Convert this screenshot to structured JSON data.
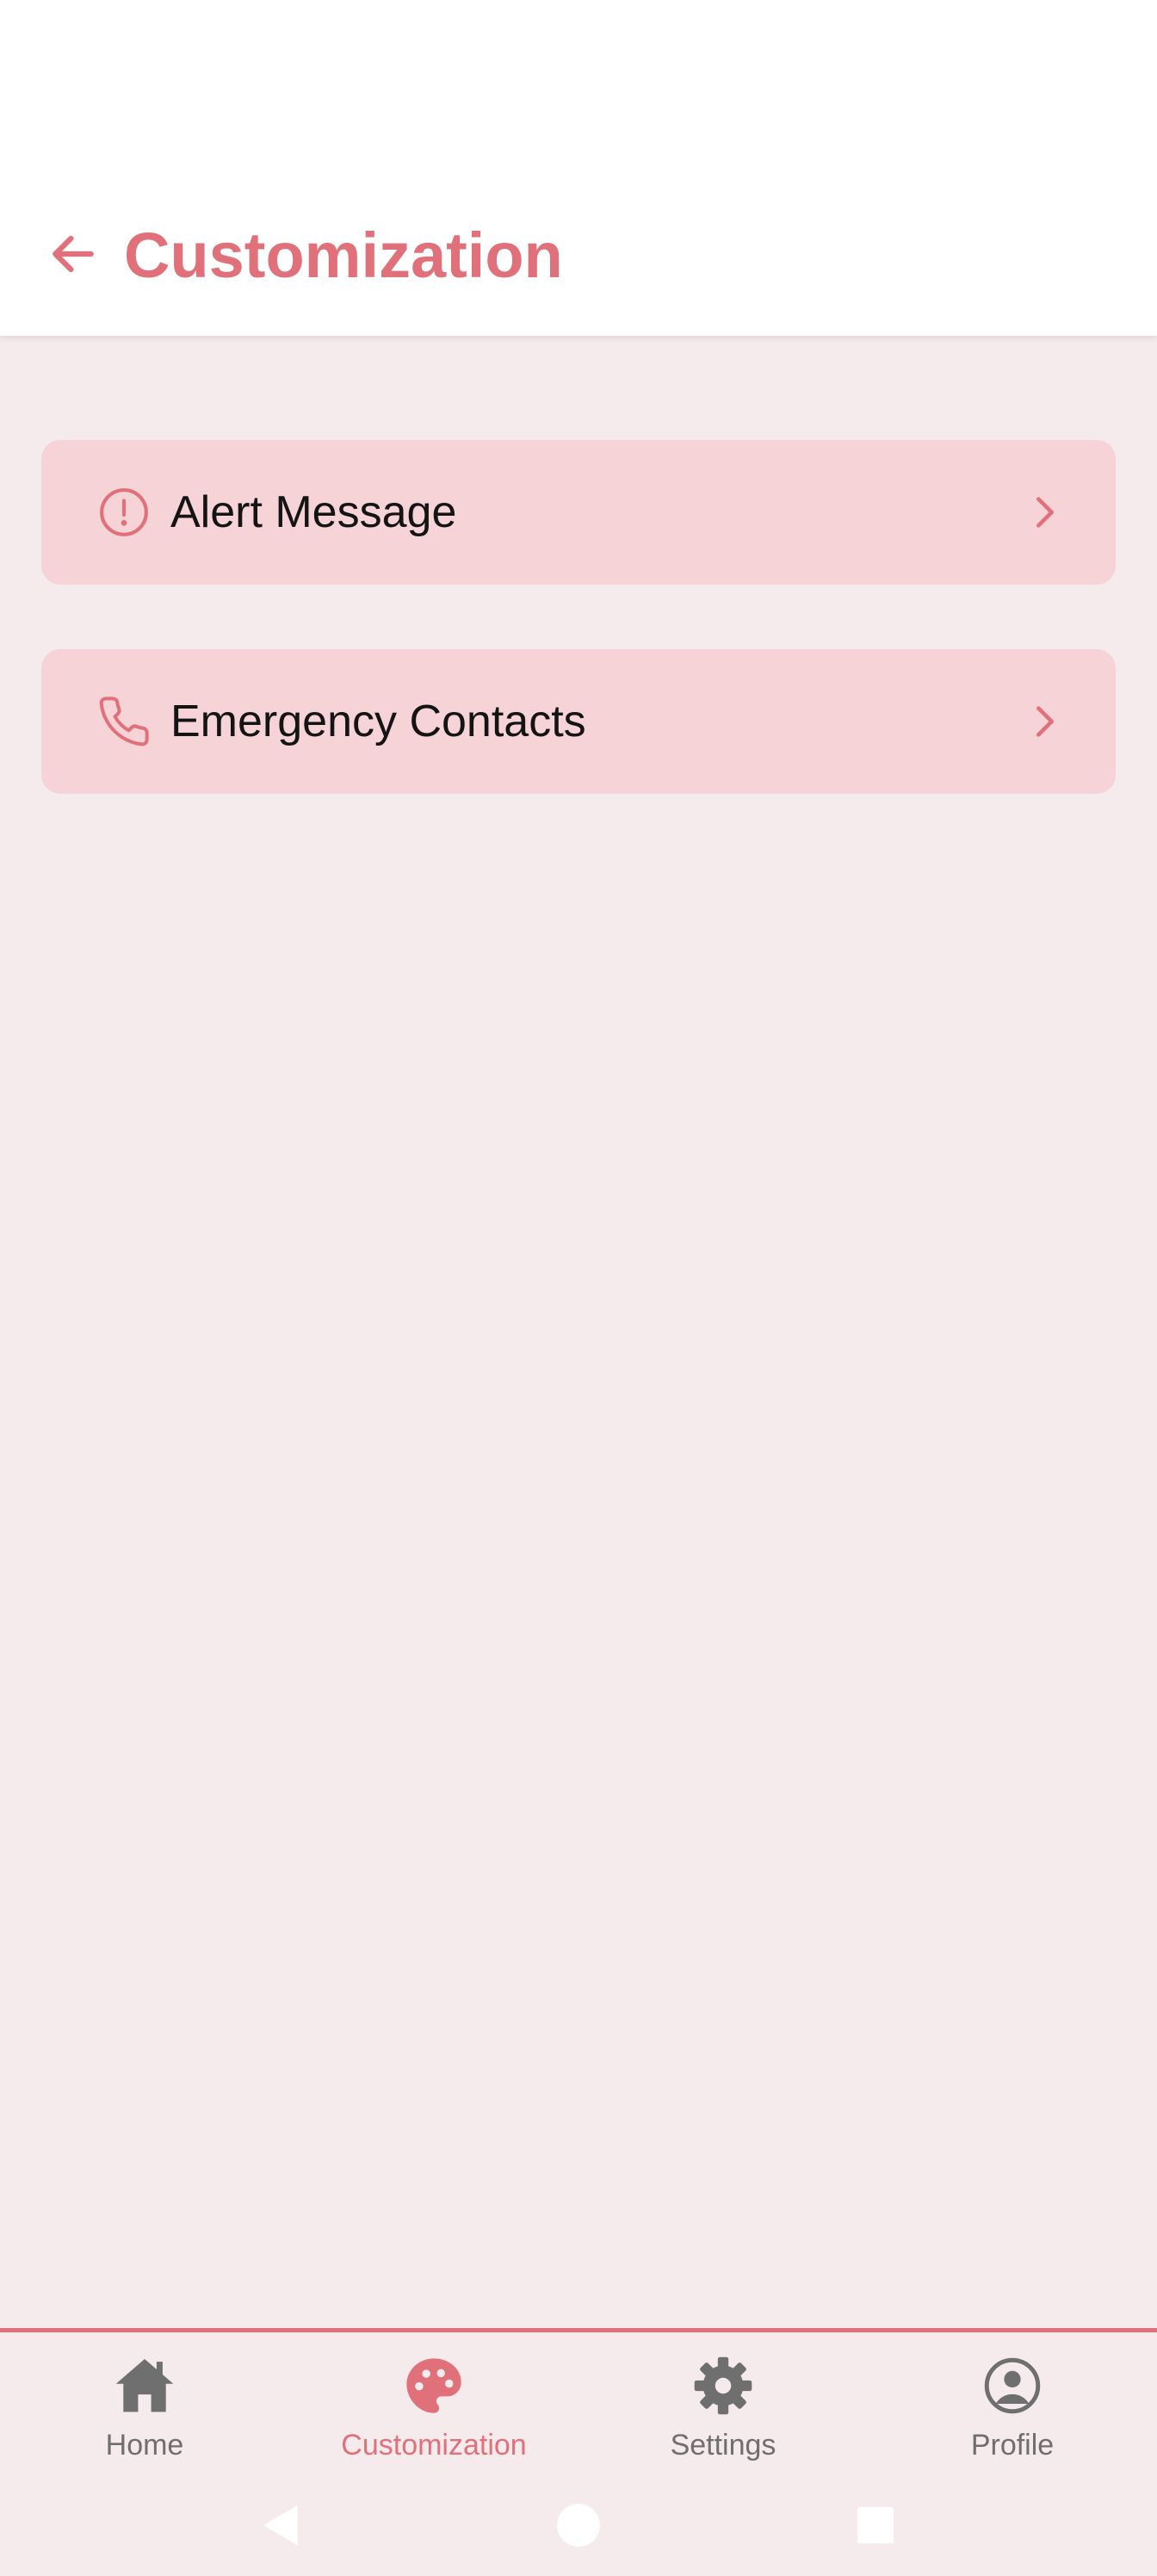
{
  "header": {
    "title": "Customization",
    "back_icon": "arrow-left-icon"
  },
  "menu": {
    "items": [
      {
        "label": "Alert Message",
        "icon": "alert-circle-icon",
        "chevron": "chevron-right-icon"
      },
      {
        "label": "Emergency Contacts",
        "icon": "phone-icon",
        "chevron": "chevron-right-icon"
      }
    ]
  },
  "bottom_nav": {
    "items": [
      {
        "label": "Home",
        "icon": "home-icon",
        "active": false
      },
      {
        "label": "Customization",
        "icon": "palette-icon",
        "active": true
      },
      {
        "label": "Settings",
        "icon": "gear-icon",
        "active": false
      },
      {
        "label": "Profile",
        "icon": "profile-icon",
        "active": false
      }
    ]
  },
  "system_nav": {
    "buttons": [
      "back-triangle-icon",
      "home-circle-icon",
      "recents-square-icon"
    ]
  },
  "colors": {
    "accent": "#E0707A",
    "card_background": "#F5D3D7",
    "page_background": "#F5EBEC",
    "header_background": "#FFFFFF",
    "inactive_nav": "#6F6F6F"
  }
}
